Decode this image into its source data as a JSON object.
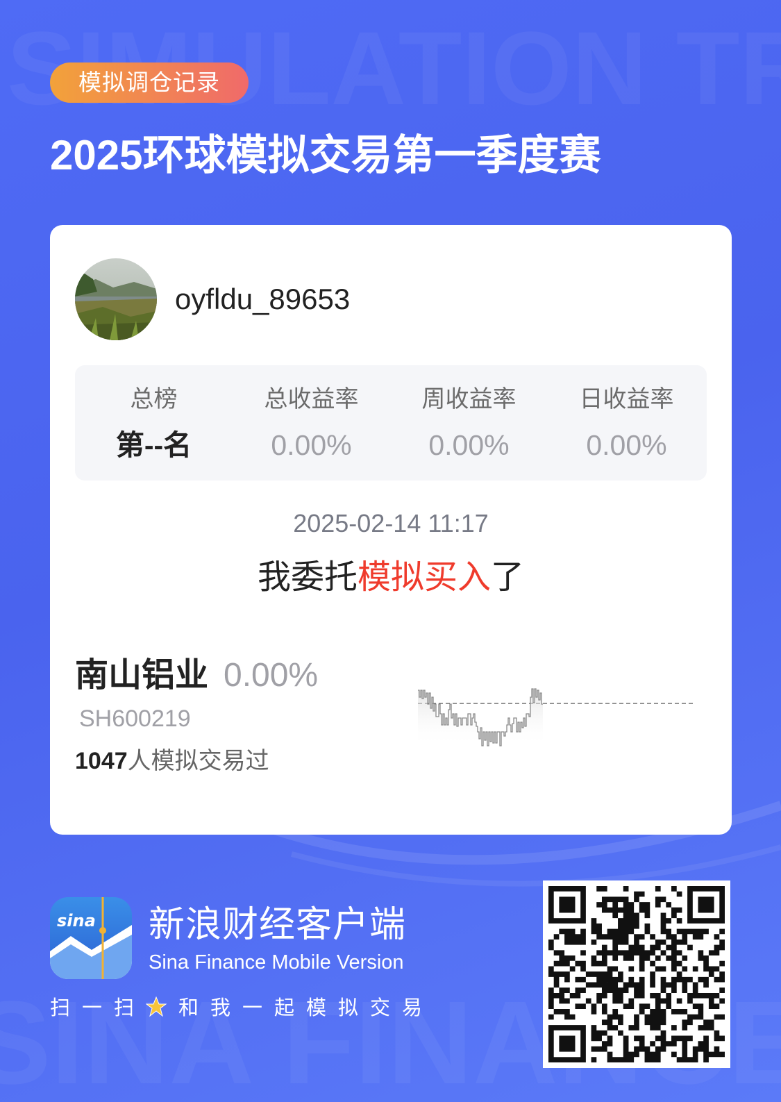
{
  "header": {
    "tag": "模拟调仓记录",
    "title": "2025环球模拟交易第一季度赛",
    "watermark": "SIMULATION TRADING"
  },
  "user": {
    "name": "oyfldu_89653"
  },
  "stats": [
    {
      "label": "总榜",
      "value": "第--名"
    },
    {
      "label": "总收益率",
      "value": "0.00%"
    },
    {
      "label": "周收益率",
      "value": "0.00%"
    },
    {
      "label": "日收益率",
      "value": "0.00%"
    }
  ],
  "trade": {
    "time": "2025-02-14 11:17",
    "action_prefix": "我委托",
    "action_highlight": "模拟买入",
    "action_suffix": "了"
  },
  "stock": {
    "name": "南山铝业",
    "change": "0.00%",
    "code": "SH600219",
    "trader_count": "1047",
    "trader_suffix": "人模拟交易过"
  },
  "footer": {
    "logo_text": "sina",
    "app_name": "新浪财经客户端",
    "app_sub": "Sina Finance Mobile Version",
    "scan_before": "扫一扫",
    "scan_after": "和我一起模拟交易",
    "watermark": "SINA FINANCE"
  },
  "colors": {
    "background": "#4f6bf5",
    "highlight": "#ef3b2c",
    "tag_gradient_start": "#f2a23a",
    "tag_gradient_end": "#f06a6a"
  },
  "icons": {
    "star": "star-icon",
    "qr": "qr-code",
    "logo": "sina-finance-app-logo"
  }
}
